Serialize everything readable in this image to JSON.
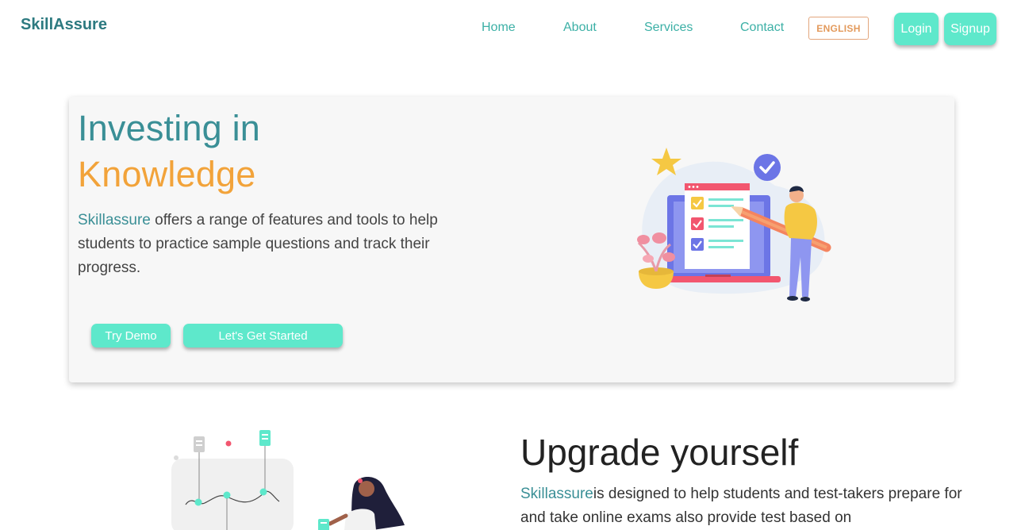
{
  "brand": "SkillAssure",
  "nav": {
    "home": "Home",
    "about": "About",
    "services": "Services",
    "contact": "Contact",
    "language": "ENGLISH",
    "login": "Login",
    "signup": "Signup"
  },
  "hero": {
    "title_line1": "Investing in",
    "title_line2": "Knowledge",
    "desc_highlight": "Skillassure",
    "desc_rest": " offers a range of features and tools to help students to practice sample questions and track their progress.",
    "try_demo": "Try Demo",
    "get_started": "Let's Get Started"
  },
  "upgrade": {
    "title": "Upgrade yourself",
    "desc_highlight": "Skillassure",
    "desc_rest": "is designed to help students and test-takers prepare for and take online exams also provide test based on"
  },
  "colors": {
    "accent": "#5ee8cb",
    "teal": "#3a8f96",
    "orange": "#f2a33a"
  }
}
